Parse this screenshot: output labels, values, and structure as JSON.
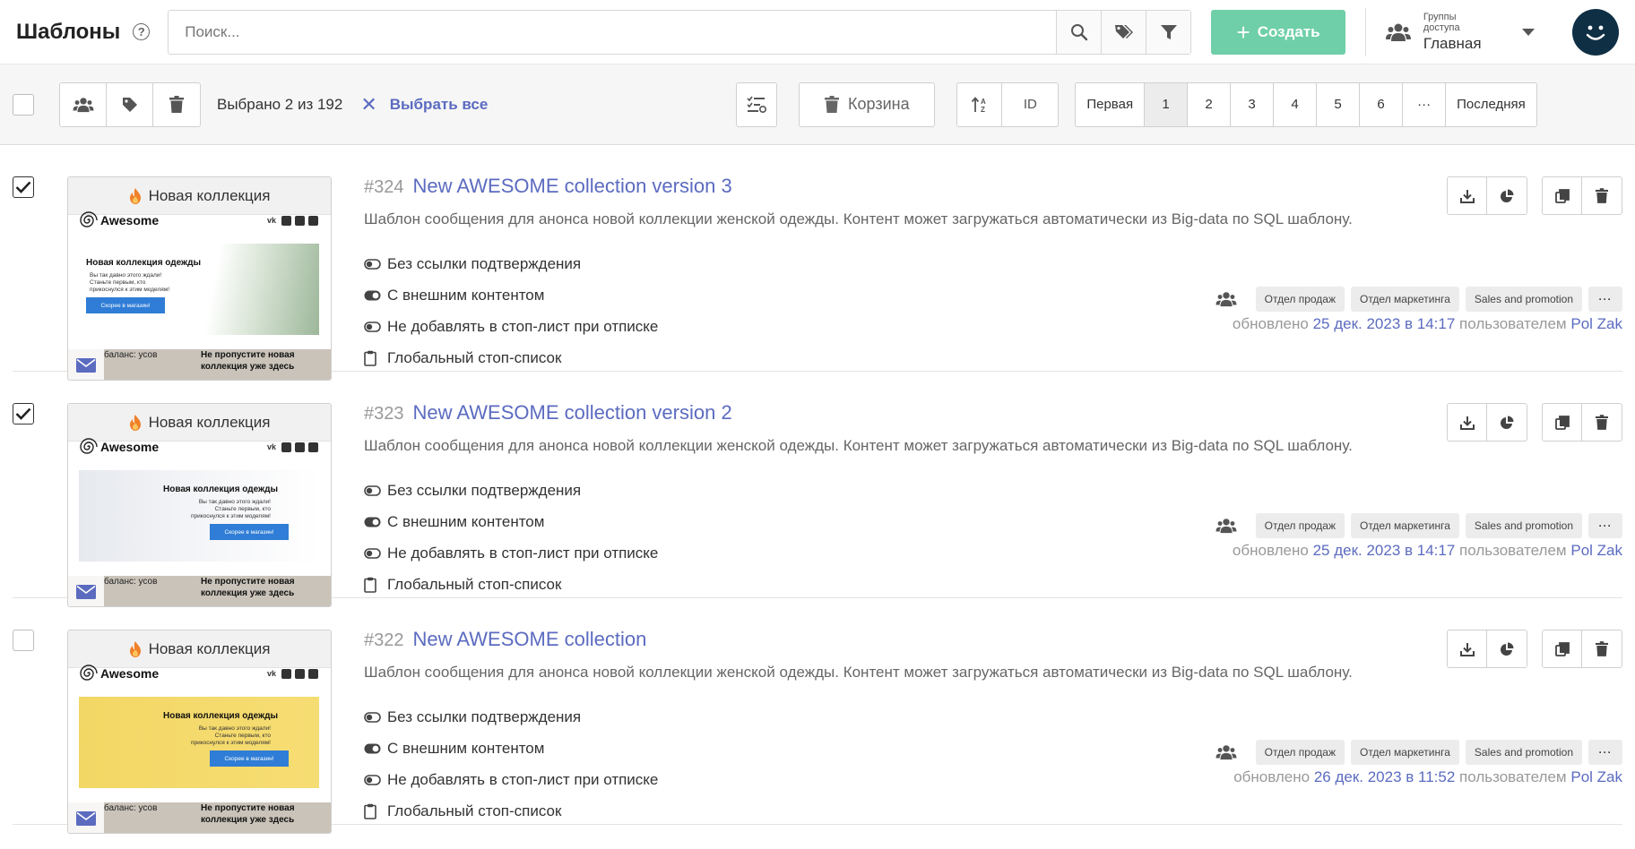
{
  "header": {
    "title": "Шаблоны",
    "help": "?",
    "search_placeholder": "Поиск...",
    "create_label": "Создать",
    "access_caption": "Группы доступа",
    "access_value": "Главная"
  },
  "toolbar": {
    "selection_text": "Выбрано 2 из 192",
    "select_all": "Выбрать все",
    "trash_label": "Корзина",
    "sort_field": "ID",
    "pager": [
      "Первая",
      "1",
      "2",
      "3",
      "4",
      "5",
      "6",
      "···",
      "Последняя"
    ],
    "active_page": "1"
  },
  "thumb": {
    "head": "Новая коллекция",
    "brand": "Awesome",
    "banner_title": "Новая коллекция одежды",
    "banner_text": "Вы так давно этого ждали! Станьте первым, кто прикоснулся к этим моделям!",
    "banner_btn": "Скорее в магазин!",
    "foot_left": "баланс: усов",
    "foot_right": "Не пропустите новая коллекция уже здесь"
  },
  "rows": [
    {
      "checked": true,
      "id": "#324",
      "title": "New AWESOME collection version 3",
      "description": "Шаблон сообщения для анонса новой коллекции женской одежды. Контент может загружаться автоматически из Big-data по SQL шаблону.",
      "options": [
        "Без ссылки подтверждения",
        "С внешним контентом",
        "Не добавлять в стоп-лист при отписке",
        "Глобальный стоп-список"
      ],
      "tags": [
        "Отдел продаж",
        "Отдел маркетинга",
        "Sales and promotion",
        "···"
      ],
      "updated_prefix": "обновлено",
      "updated_date": "25 дек. 2023 в 14:17",
      "updated_by": "пользователем",
      "user": "Pol Zak"
    },
    {
      "checked": true,
      "id": "#323",
      "title": "New AWESOME collection version 2",
      "description": "Шаблон сообщения для анонса новой коллекции женской одежды. Контент может загружаться автоматически из Big-data по SQL шаблону.",
      "options": [
        "Без ссылки подтверждения",
        "С внешним контентом",
        "Не добавлять в стоп-лист при отписке",
        "Глобальный стоп-список"
      ],
      "tags": [
        "Отдел продаж",
        "Отдел маркетинга",
        "Sales and promotion",
        "···"
      ],
      "updated_prefix": "обновлено",
      "updated_date": "25 дек. 2023 в 14:17",
      "updated_by": "пользователем",
      "user": "Pol Zak"
    },
    {
      "checked": false,
      "id": "#322",
      "title": "New AWESOME collection",
      "description": "Шаблон сообщения для анонса новой коллекции женской одежды. Контент может загружаться автоматически из Big-data по SQL шаблону.",
      "options": [
        "Без ссылки подтверждения",
        "С внешним контентом",
        "Не добавлять в стоп-лист при отписке",
        "Глобальный стоп-список"
      ],
      "tags": [
        "Отдел продаж",
        "Отдел маркетинга",
        "Sales and promotion",
        "···"
      ],
      "updated_prefix": "обновлено",
      "updated_date": "26 дек. 2023 в 11:52",
      "updated_by": "пользователем",
      "user": "Pol Zak"
    }
  ],
  "colors": {
    "accent": "#5b6bc0",
    "create": "#6fcfa8",
    "avatar": "#0f2f45"
  }
}
